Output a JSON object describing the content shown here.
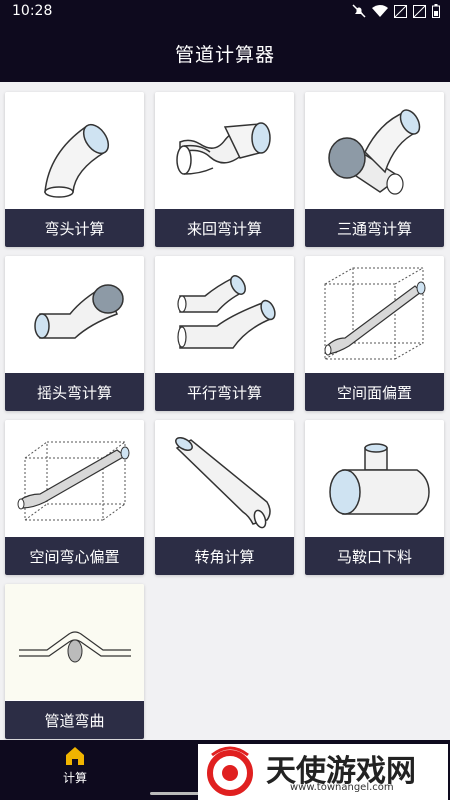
{
  "status_bar": {
    "time": "10:28",
    "icons": [
      "mute-icon",
      "wifi-icon",
      "signal-off-icon",
      "signal-off-icon",
      "battery-icon"
    ]
  },
  "header": {
    "title": "管道计算器"
  },
  "cards": [
    {
      "label": "弯头计算",
      "icon": "elbow-pipe-icon"
    },
    {
      "label": "来回弯计算",
      "icon": "offset-pipe-icon"
    },
    {
      "label": "三通弯计算",
      "icon": "tee-pipe-icon"
    },
    {
      "label": "摇头弯计算",
      "icon": "swing-pipe-icon"
    },
    {
      "label": "平行弯计算",
      "icon": "parallel-pipe-icon"
    },
    {
      "label": "空间面偏置",
      "icon": "space-offset-icon"
    },
    {
      "label": "空间弯心偏置",
      "icon": "space-bend-offset-icon"
    },
    {
      "label": "转角计算",
      "icon": "corner-pipe-icon"
    },
    {
      "label": "马鞍口下料",
      "icon": "saddle-pipe-icon"
    },
    {
      "label": "管道弯曲",
      "icon": "pipe-bend-icon"
    }
  ],
  "bottom_nav": {
    "home_label": "计算",
    "home_icon": "home-icon"
  },
  "watermark": {
    "cn": "天使游戏网",
    "url": "www.townangel.com",
    "logo": "townangel-logo"
  }
}
